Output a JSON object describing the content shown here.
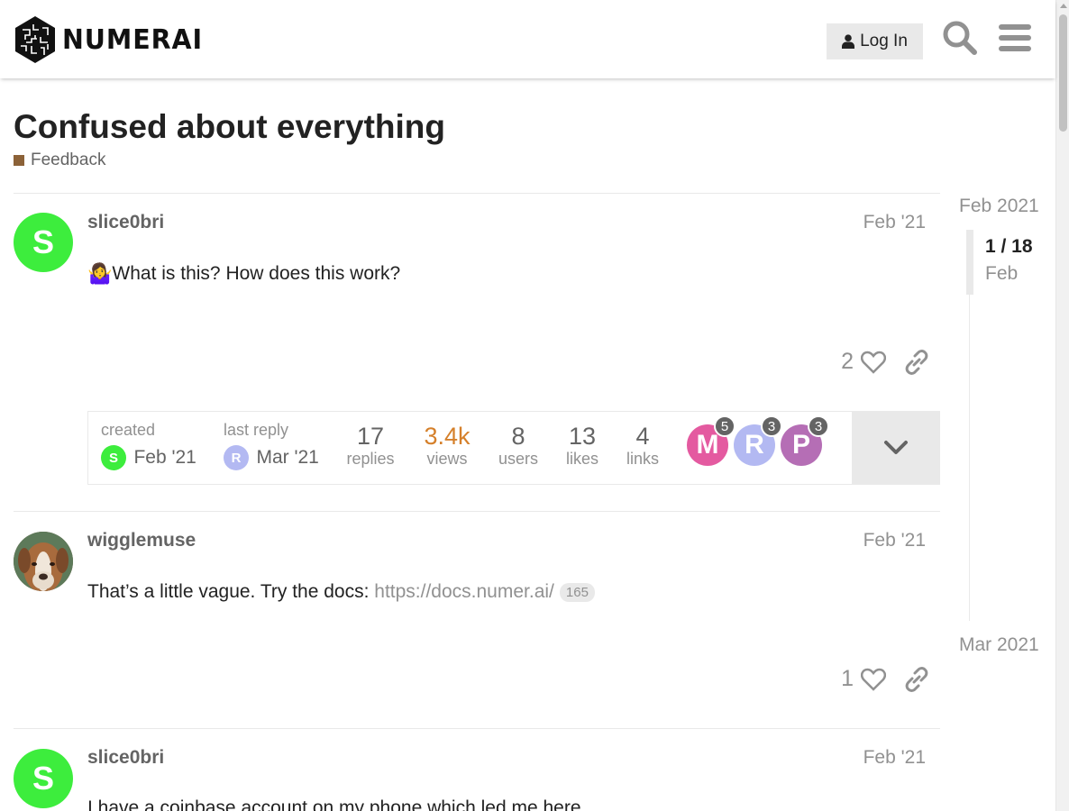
{
  "header": {
    "brand": "NUMERAI",
    "login_label": "Log In",
    "search_icon": "search-icon",
    "menu_icon": "hamburger-menu-icon"
  },
  "topic": {
    "title": "Confused about everything",
    "category": "Feedback",
    "category_color": "#8c6238"
  },
  "posts": [
    {
      "username": "slice0bri",
      "avatar_letter": "S",
      "avatar_color": "#3ded3d",
      "date": "Feb '21",
      "emoji": "🤷‍♀️",
      "body": "What is this? How does this work?",
      "likes": "2"
    },
    {
      "username": "wigglemuse",
      "date": "Feb '21",
      "body": "That’s a little vague. Try the docs: ",
      "link": "https://docs.numer.ai/",
      "link_clicks": "165",
      "likes": "1"
    },
    {
      "username": "slice0bri",
      "avatar_letter": "S",
      "avatar_color": "#3ded3d",
      "date": "Feb '21",
      "body": "I have a coinbase account on my phone which led me here"
    }
  ],
  "topic_map": {
    "created_label": "created",
    "created_date": "Feb '21",
    "created_avatar": "S",
    "last_reply_label": "last reply",
    "last_reply_date": "Mar '21",
    "last_reply_avatar": "R",
    "replies": "17",
    "replies_label": "replies",
    "views": "3.4k",
    "views_label": "views",
    "users": "8",
    "users_label": "users",
    "likes": "13",
    "likes_label": "likes",
    "links": "4",
    "links_label": "links",
    "participants": [
      {
        "letter": "M",
        "count": "5",
        "color": "#e45aa0"
      },
      {
        "letter": "R",
        "count": "3",
        "color": "#b3b9f2"
      },
      {
        "letter": "P",
        "count": "3",
        "color": "#b56eb5"
      }
    ]
  },
  "timeline": {
    "start": "Feb 2021",
    "position": "1 / 18",
    "month": "Feb",
    "end": "Mar 2021"
  }
}
